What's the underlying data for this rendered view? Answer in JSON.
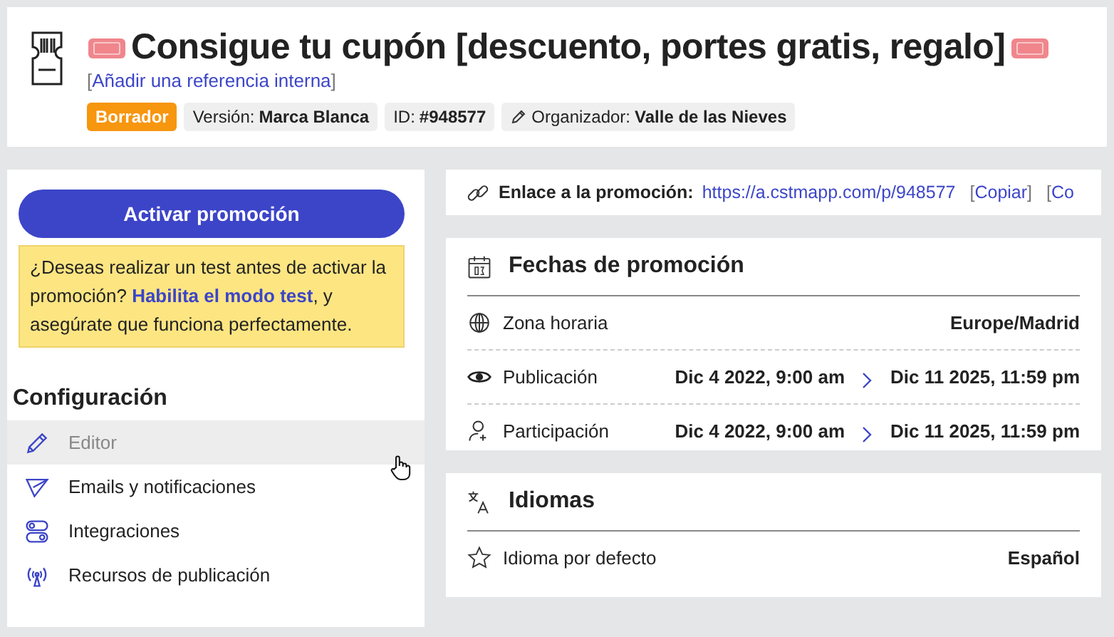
{
  "header": {
    "title": "Consigue tu cupón [descuento, portes gratis, regalo]",
    "reference": {
      "open": "[",
      "label": "Añadir una referencia interna",
      "close": "]"
    },
    "tags": [
      {
        "kind": "status",
        "label": "Borrador"
      },
      {
        "kind": "field",
        "label": "Versión:",
        "value": "Marca Blanca"
      },
      {
        "kind": "field",
        "label": "ID:",
        "value": "#948577"
      },
      {
        "kind": "organizer",
        "label": "Organizador:",
        "value": "Valle de las Nieves"
      }
    ]
  },
  "sidebar": {
    "activate_button": "Activar promoción",
    "notice": {
      "before": "¿Deseas realizar un test antes de activar la promoción?",
      "link": "Habilita el modo test",
      "after": ", y asegúrate que funciona perfectamente."
    },
    "section_title": "Configuración",
    "items": [
      {
        "kind": "editor",
        "label": "Editor",
        "selected": true
      },
      {
        "kind": "emails",
        "label": "Emails y notificaciones",
        "selected": false
      },
      {
        "kind": "integrations",
        "label": "Integraciones",
        "selected": false
      },
      {
        "kind": "resources",
        "label": "Recursos de publicación",
        "selected": false
      }
    ]
  },
  "link_bar": {
    "label": "Enlace a la promoción:",
    "url": "https://a.cstmapp.com/p/948577",
    "actions": [
      {
        "open": "[",
        "label": "Copiar",
        "close": "]"
      },
      {
        "open": "[",
        "label": "Co"
      }
    ]
  },
  "dates": {
    "title": "Fechas de promoción",
    "rows": [
      {
        "kind": "timezone",
        "label": "Zona horaria",
        "value": "Europe/Madrid"
      },
      {
        "kind": "publication",
        "label": "Publicación",
        "start": "Dic 4 2022, 9:00 am",
        "end": "Dic 11 2025, 11:59 pm"
      },
      {
        "kind": "participation",
        "label": "Participación",
        "start": "Dic 4 2022, 9:00 am",
        "end": "Dic 11 2025, 11:59 pm"
      }
    ]
  },
  "languages": {
    "title": "Idiomas",
    "rows": [
      {
        "label": "Idioma por defecto",
        "value": "Español"
      }
    ]
  }
}
